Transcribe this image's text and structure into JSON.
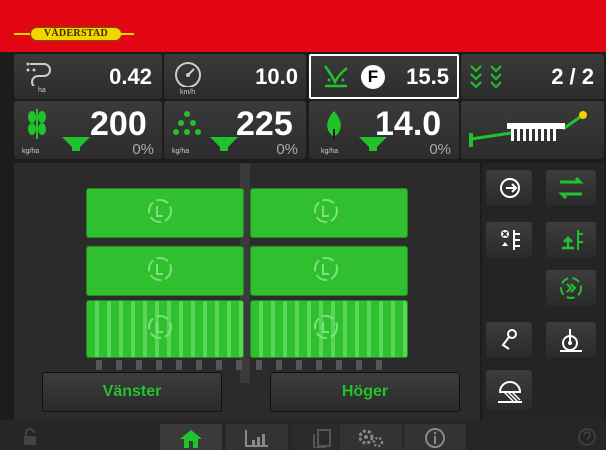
{
  "header": {
    "brand": "VÄDERSTAD"
  },
  "top_row": {
    "area": {
      "value": "0.42",
      "unit": "ha"
    },
    "speed": {
      "value": "10.0",
      "unit": "km/h"
    },
    "fan": {
      "mode_letter": "F",
      "value": "15.5"
    },
    "rows": {
      "value": "2 / 2"
    }
  },
  "rates": {
    "seed": {
      "value": "200",
      "unit": "kg/ha",
      "percent": "0%"
    },
    "fertilizer": {
      "value": "225",
      "unit": "kg/ha",
      "percent": "0%"
    },
    "micro": {
      "value": "14.0",
      "unit": "kg/ha",
      "percent": "0%"
    }
  },
  "sections": {
    "left_label": "Vänster",
    "right_label": "Höger"
  },
  "colors": {
    "brand_red": "#e30613",
    "brand_yellow": "#f2d400",
    "accent_green": "#21c32c"
  }
}
